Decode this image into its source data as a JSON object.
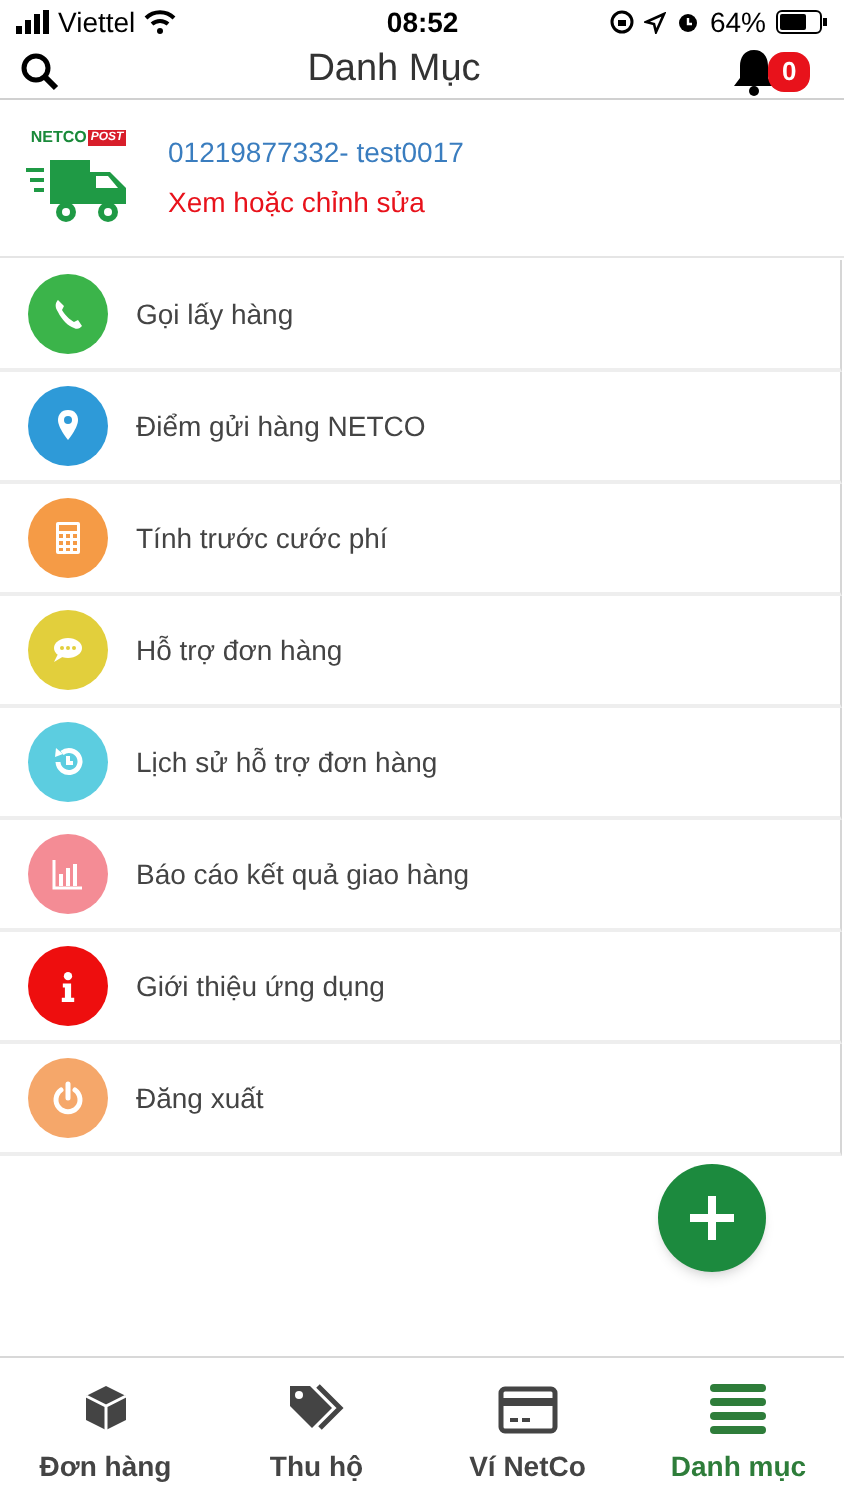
{
  "status_bar": {
    "carrier": "Viettel",
    "time": "08:52",
    "battery": "64%"
  },
  "header": {
    "title": "Danh Mục",
    "notification_count": "0"
  },
  "profile": {
    "logo_text": "NETCO",
    "logo_badge": "POST",
    "account": "01219877332- test0017",
    "edit_link": "Xem hoặc chỉnh sửa"
  },
  "menu": [
    {
      "kind": "phone",
      "label": "Gọi lấy hàng",
      "color": "#3bb44a"
    },
    {
      "kind": "pin",
      "label": "Điểm gửi hàng NETCO",
      "color": "#2e9ad8"
    },
    {
      "kind": "calculator",
      "label": "Tính trước cước phí",
      "color": "#f59b46"
    },
    {
      "kind": "chat",
      "label": "Hỗ trợ đơn hàng",
      "color": "#e2cf3c"
    },
    {
      "kind": "history",
      "label": "Lịch sử hỗ trợ đơn hàng",
      "color": "#5ccde0"
    },
    {
      "kind": "chart",
      "label": "Báo cáo kết quả giao hàng",
      "color": "#f48c95"
    },
    {
      "kind": "info",
      "label": "Giới thiệu ứng dụng",
      "color": "#ee0e0e"
    },
    {
      "kind": "power",
      "label": "Đăng xuất",
      "color": "#f5a76a"
    }
  ],
  "tabs": [
    {
      "kind": "box",
      "label": "Đơn hàng",
      "selected": false
    },
    {
      "kind": "tags",
      "label": "Thu hộ",
      "selected": false
    },
    {
      "kind": "card",
      "label": "Ví NetCo",
      "selected": false
    },
    {
      "kind": "list",
      "label": "Danh mục",
      "selected": true
    }
  ]
}
